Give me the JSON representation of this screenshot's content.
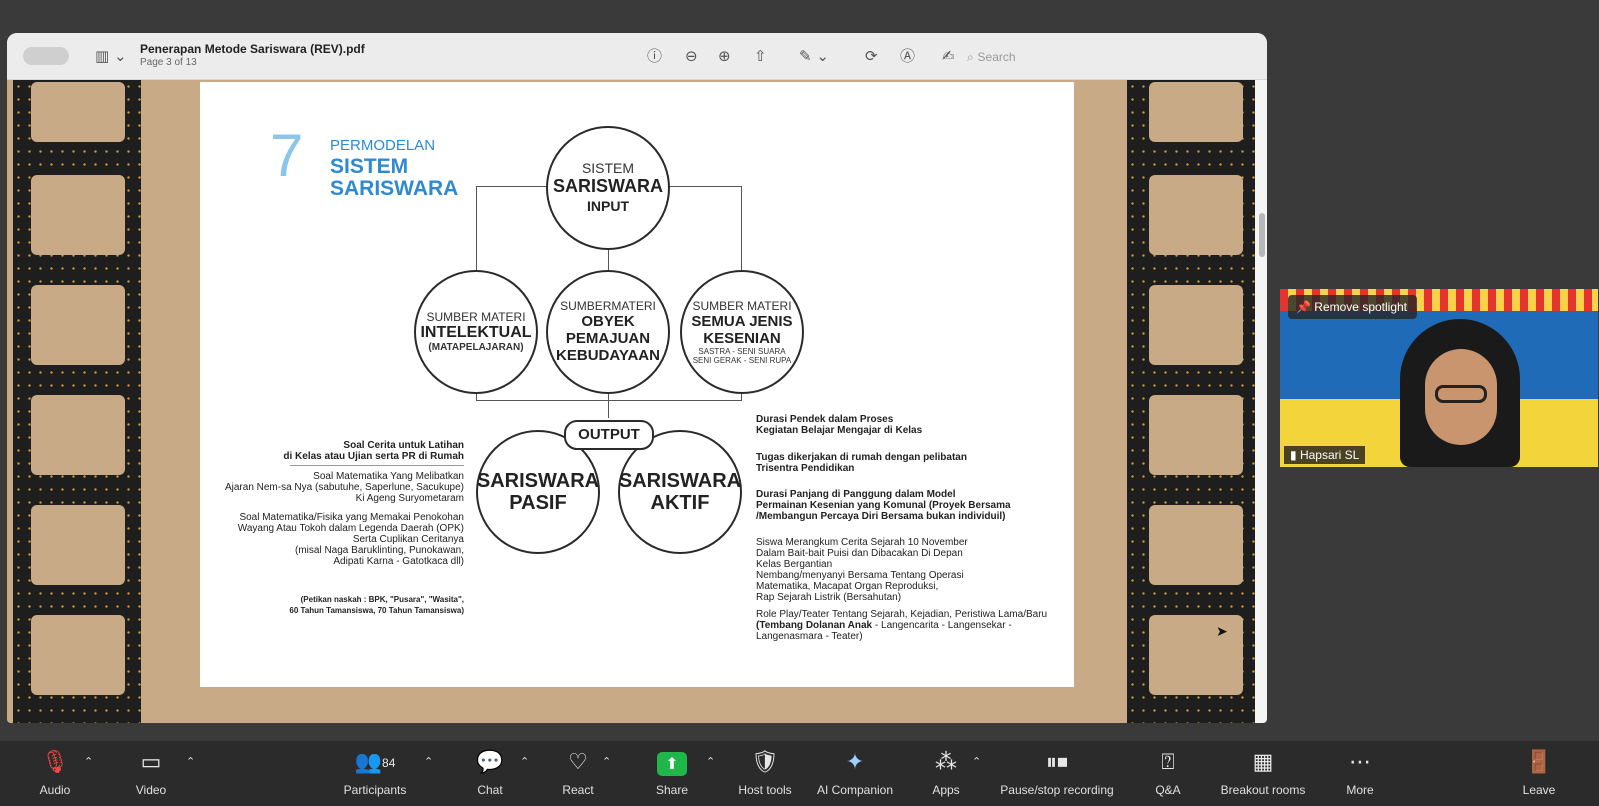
{
  "viewer": {
    "title": "Penerapan Metode Sariswara (REV).pdf",
    "page_info": "Page 3 of 13",
    "search_placeholder": "Search",
    "toolbar_icons": [
      "sidebar-toggle-icon",
      "info-icon",
      "zoom-out-icon",
      "zoom-in-icon",
      "share-icon",
      "markup-pen-icon",
      "rotate-icon",
      "annotate-icon",
      "signature-icon",
      "search-icon"
    ]
  },
  "slide": {
    "number": "7",
    "heading_small": "PERMODELAN",
    "heading_big1": "SISTEM",
    "heading_big2": "SARISWARA",
    "input": {
      "l1": "SISTEM",
      "l2": "SARISWARA",
      "l3": "INPUT"
    },
    "sources": [
      {
        "l1": "SUMBER MATERI",
        "l2": "INTELEKTUAL",
        "l3": "(MATAPELAJARAN)"
      },
      {
        "l1": "SUMBERMATERI",
        "l2": "OBYEK",
        "l3": "PEMAJUAN",
        "l4": "KEBUDAYAAN"
      },
      {
        "l1": "SUMBER MATERI",
        "l2": "SEMUA JENIS",
        "l3": "KESENIAN",
        "l4": "SASTRA - SENI SUARA",
        "l5": "SENI GERAK - SENI RUPA"
      }
    ],
    "output_label": "OUTPUT",
    "pasif": {
      "l1": "SARISWARA",
      "l2": "PASIF"
    },
    "aktif": {
      "l1": "SARISWARA",
      "l2": "AKTIF"
    },
    "left_text": {
      "b1": "Soal Cerita untuk Latihan",
      "b2": "di Kelas atau Ujian serta PR di Rumah",
      "p1": [
        "Soal Matematika Yang Melibatkan",
        "Ajaran Nem-sa Nya (sabutuhe, Saperlune, Sacukupe)",
        "Ki Ageng Suryometaram"
      ],
      "p2": [
        "Soal Matematika/Fisika yang Memakai Penokohan",
        "Wayang Atau Tokoh dalam Legenda Daerah (OPK)",
        "Serta Cuplikan Ceritanya",
        "(misal Naga Baruklinting, Punokawan,",
        "Adipati Karna - Gatotkaca dll)"
      ],
      "note": [
        "(Petikan naskah : BPK, \"Pusara\", \"Wasita\",",
        "60 Tahun Tamansiswa, 70 Tahun Tamansiswa)"
      ]
    },
    "right_text": {
      "h1": [
        "Durasi Pendek dalam Proses",
        "Kegiatan Belajar Mengajar di Kelas"
      ],
      "h2": [
        "Tugas dikerjakan di rumah dengan pelibatan",
        "Trisentra Pendidikan"
      ],
      "h3": [
        "Durasi Panjang di Panggung dalam Model",
        "Permainan Kesenian yang Komunal (Proyek Bersama",
        "/Membangun Percaya Diri Bersama bukan individuil)"
      ],
      "p1": [
        "Siswa Merangkum Cerita Sejarah 10 November",
        "Dalam Bait-bait Puisi dan Dibacakan Di Depan",
        "Kelas Bergantian",
        "Nembang/menyanyi Bersama Tentang Operasi",
        "Matematika, Macapat Organ Reproduksi,",
        "Rap Sejarah Listrik (Bersahutan)"
      ],
      "p2a": "Role Play/Teater Tentang Sejarah, Kejadian, Peristiwa Lama/Baru",
      "p2b_bold": "(Tembang Dolanan Anak",
      "p2b_rest": " - Langencarita - Langensekar -",
      "p2c": "Langenasmara - Teater)"
    }
  },
  "video": {
    "spotlight_label": "Remove spotlight",
    "participant_name": "Hapsari SL"
  },
  "toolbar": {
    "audio": "Audio",
    "video": "Video",
    "participants": "Participants",
    "participant_count": "84",
    "chat": "Chat",
    "react": "React",
    "share": "Share",
    "host_tools": "Host tools",
    "ai_companion": "AI Companion",
    "apps": "Apps",
    "recording": "Pause/stop recording",
    "qa": "Q&A",
    "breakout": "Breakout rooms",
    "more": "More",
    "leave": "Leave"
  },
  "colors": {
    "accent_blue": "#2f8ad0",
    "share_green": "#1fb64a",
    "leave_red": "#e0463c"
  }
}
